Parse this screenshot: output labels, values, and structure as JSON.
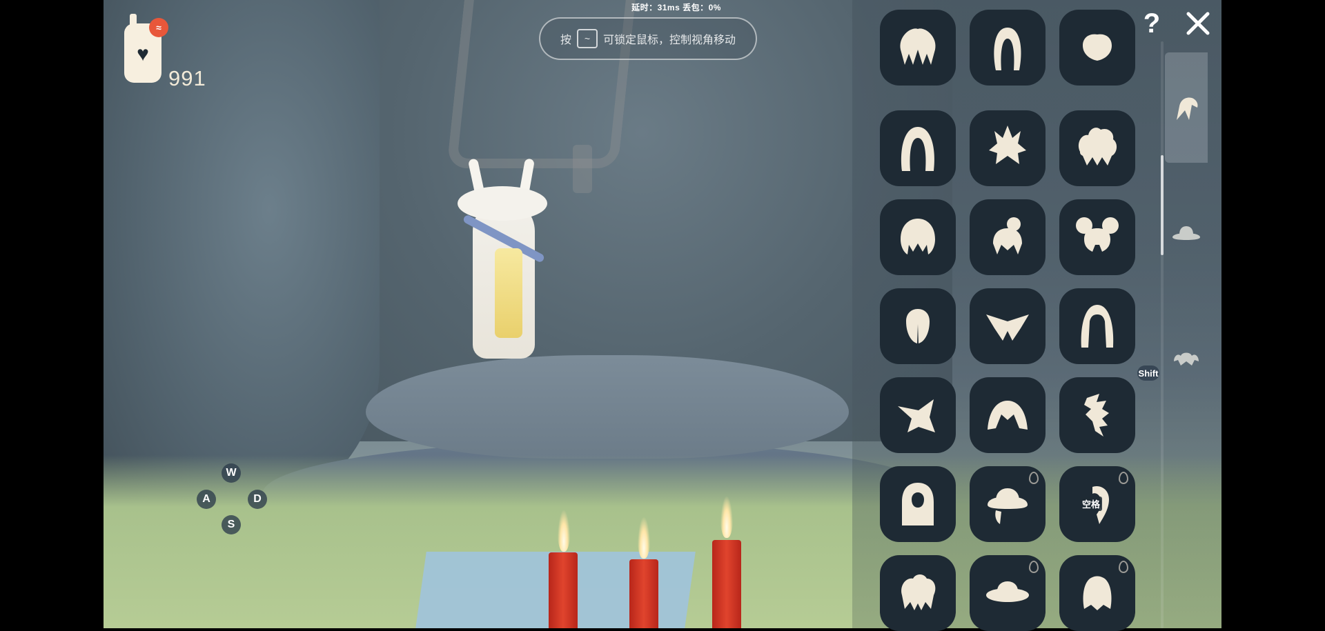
{
  "status": {
    "text": "延时：31ms    丢包：0%"
  },
  "hint": {
    "prefix": "按",
    "key": "~",
    "text": "可锁定鼠标，控制视角移动"
  },
  "hud": {
    "candle_count": "991",
    "phone_badge": "≈"
  },
  "keys": {
    "w": "W",
    "a": "A",
    "s": "S",
    "d": "D",
    "shift": "Shift"
  },
  "panel": {
    "help": "?",
    "categories": [
      {
        "name": "hair",
        "selected": true
      },
      {
        "name": "hat",
        "selected": false
      },
      {
        "name": "accessory",
        "selected": false
      }
    ],
    "tiles": [
      {
        "icon": "hair-style-icon"
      },
      {
        "icon": "hair-long-icon"
      },
      {
        "icon": "hair-short-icon"
      },
      {
        "icon": "hair-long-straight-icon"
      },
      {
        "icon": "hair-spiky-icon"
      },
      {
        "icon": "hair-curly-icon"
      },
      {
        "icon": "hair-round-icon"
      },
      {
        "icon": "hair-bun-icon"
      },
      {
        "icon": "hair-pigtail-buns-icon"
      },
      {
        "icon": "hair-bob-icon"
      },
      {
        "icon": "hair-wings-icon"
      },
      {
        "icon": "hair-braids-icon"
      },
      {
        "icon": "hair-side-swept-icon"
      },
      {
        "icon": "hair-parted-icon"
      },
      {
        "icon": "hair-wavy-tail-icon"
      },
      {
        "icon": "hood-icon"
      },
      {
        "icon": "hat-brim-icon",
        "locked": true
      },
      {
        "icon": "hair-ponytail-icon",
        "locked": true,
        "label": "空格"
      },
      {
        "icon": "hair-curly-short-icon"
      },
      {
        "icon": "hat-disc-icon",
        "locked": true
      },
      {
        "icon": "hair-tied-icon",
        "locked": true
      }
    ]
  },
  "colors": {
    "accent": "#f0e8d8",
    "tile_bg": "#1e2a34",
    "candle": "#d43a28"
  }
}
